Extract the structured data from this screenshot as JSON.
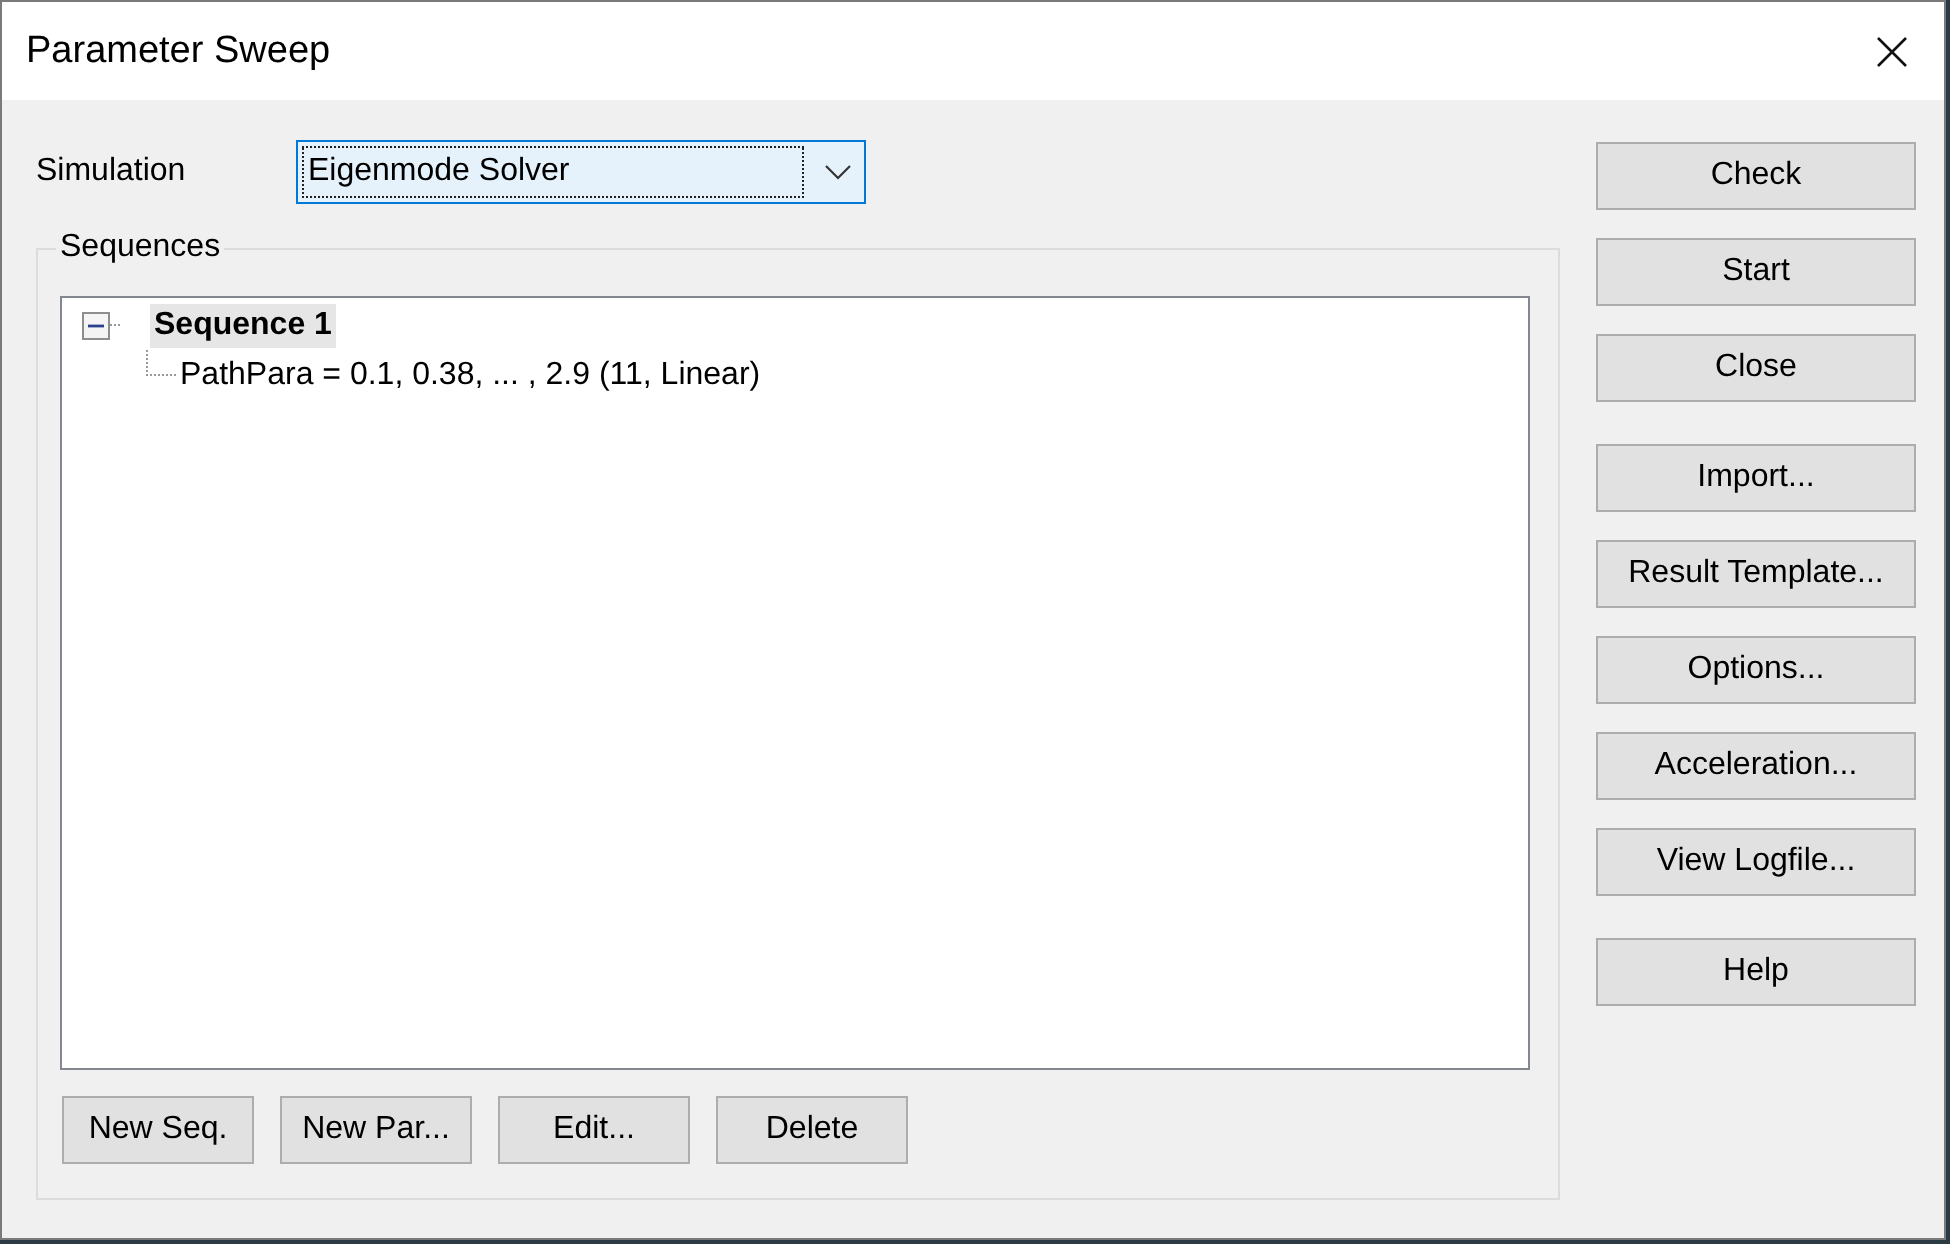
{
  "window": {
    "title": "Parameter Sweep"
  },
  "simulation": {
    "label": "Simulation",
    "value": "Eigenmode Solver",
    "focused": true
  },
  "sequences": {
    "label": "Sequences",
    "tree": [
      {
        "kind": "sequence",
        "label": "Sequence 1",
        "selected": true,
        "expanded": true,
        "children": [
          {
            "kind": "parameter",
            "label": "PathPara = 0.1, 0.38, ... , 2.9 (11, Linear)",
            "selected": false
          }
        ]
      }
    ],
    "buttons": [
      "New Seq.",
      "New Par...",
      "Edit...",
      "Delete"
    ]
  },
  "side_button_groups": [
    [
      "Check",
      "Start",
      "Close"
    ],
    [
      "Import...",
      "Result Template...",
      "Options...",
      "Acceleration...",
      "View Logfile..."
    ],
    [
      "Help"
    ]
  ]
}
